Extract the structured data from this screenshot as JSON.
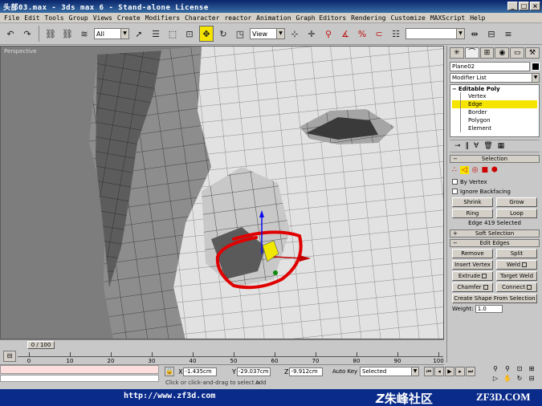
{
  "window": {
    "title": "头部03.max - 3ds max 6 - Stand-alone License",
    "buttons": [
      "_",
      "□",
      "×"
    ]
  },
  "menu": [
    "File",
    "Edit",
    "Tools",
    "Group",
    "Views",
    "Create",
    "Modifiers",
    "Character",
    "reactor",
    "Animation",
    "Graph Editors",
    "Rendering",
    "Customize",
    "MAXScript",
    "Help"
  ],
  "toolbar": {
    "selection_filter": "All",
    "reference_coord": "View",
    "named_selection": ""
  },
  "viewport": {
    "label": "Perspective"
  },
  "command_panel": {
    "object_name": "Plane02",
    "modifier_list": "Modifier List",
    "stack": {
      "top": "Editable Poly",
      "subobjects": [
        "Vertex",
        "Edge",
        "Border",
        "Polygon",
        "Element"
      ],
      "selected": "Edge"
    },
    "selection": {
      "title": "Selection",
      "by_vertex": "By Vertex",
      "ignore_backfacing": "Ignore Backfacing",
      "shrink": "Shrink",
      "grow": "Grow",
      "ring": "Ring",
      "loop": "Loop",
      "status": "Edge 419 Selected"
    },
    "soft_selection": {
      "title": "Soft Selection"
    },
    "edit_edges": {
      "title": "Edit Edges",
      "remove": "Remove",
      "split": "Split",
      "insert_vertex": "Insert Vertex",
      "weld": "Weld",
      "extrude": "Extrude",
      "target_weld": "Target Weld",
      "chamfer": "Chamfer",
      "connect": "Connect",
      "create_shape": "Create Shape From Selection",
      "weight_label": "Weight:",
      "weight_value": "1.0"
    }
  },
  "timeline": {
    "frame": "0 / 100",
    "ticks": [
      "0",
      "10",
      "20",
      "30",
      "40",
      "50",
      "60",
      "70",
      "80",
      "90",
      "100"
    ]
  },
  "status": {
    "x_label": "X",
    "x_value": "-1.435cm",
    "y_label": "Y",
    "y_value": "-29.037cm",
    "z_label": "Z",
    "z_value": "-9.912cm",
    "prompt": "Click or click-and-drag to select o",
    "add_label": "Add",
    "auto_key": "Auto Key",
    "selected_set": "Selected"
  },
  "footer": {
    "url": "http://www.zf3d.com",
    "brand_cn": "朱峰社区",
    "brand_en": "ZF3D.COM"
  }
}
